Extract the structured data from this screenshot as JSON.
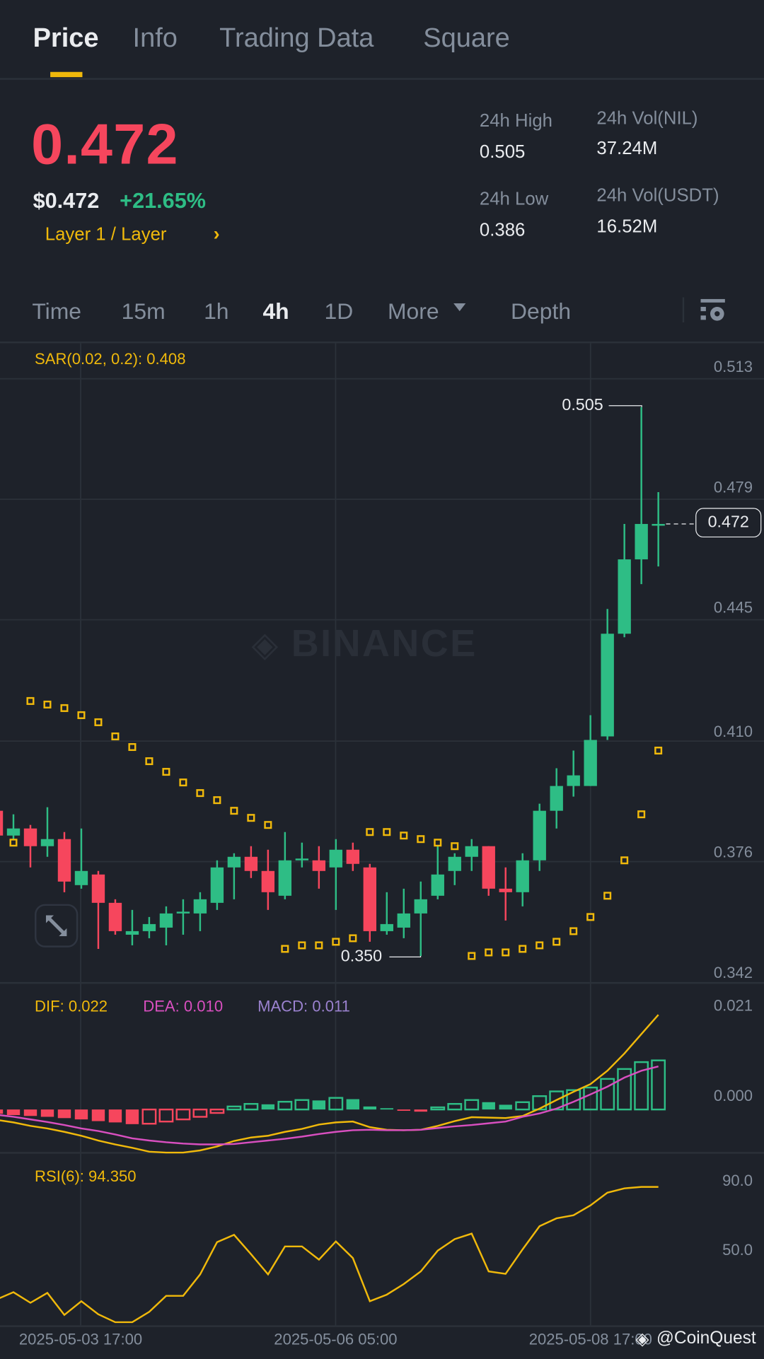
{
  "tabs": [
    {
      "label": "Price",
      "active": true
    },
    {
      "label": "Info"
    },
    {
      "label": "Trading Data"
    },
    {
      "label": "Square"
    }
  ],
  "ticker": {
    "last_price": "0.472",
    "usd_price": "$0.472",
    "change": "+21.65%",
    "category": "Layer 1 / Layer",
    "category_chevron": "›",
    "stats": [
      {
        "label": "24h High",
        "value": "0.505"
      },
      {
        "label": "24h Vol(NIL)",
        "value": "37.24M"
      },
      {
        "label": "24h Low",
        "value": "0.386"
      },
      {
        "label": "24h Vol(USDT)",
        "value": "16.52M"
      }
    ]
  },
  "intervals": {
    "items": [
      "Time",
      "15m",
      "1h",
      "4h",
      "1D"
    ],
    "active": "4h",
    "more": "More",
    "depth": "Depth",
    "settings_icon": "chart-settings-icon"
  },
  "chart": {
    "sar_label": "SAR(0.02, 0.2): 0.408",
    "watermark": "BINANCE",
    "high_marker": "0.505",
    "low_marker": "0.350",
    "current_price": "0.472",
    "macd": {
      "dif": "DIF: 0.022",
      "dea": "DEA: 0.010",
      "macd": "MACD: 0.011"
    },
    "rsi_label": "RSI(6): 94.350",
    "credit": "@CoinQuest",
    "expand_icon": "expand-icon"
  },
  "colors": {
    "up": "#2ebd85",
    "down": "#f6465d",
    "accent": "#f0b90b",
    "dea": "#d94fc0",
    "macd_label": "#9b82cf"
  },
  "chart_data": {
    "type": "candlestick",
    "interval": "4h",
    "price_ticks": [
      "0.513",
      "0.479",
      "0.445",
      "0.410",
      "0.376",
      "0.342"
    ],
    "macd_ticks": [
      "0.021",
      "0.000"
    ],
    "rsi_ticks": [
      "90.0",
      "50.0"
    ],
    "x_labels": [
      "2025-05-03 17:00",
      "2025-05-06 05:00",
      "2025-05-08 17:00"
    ],
    "ohlc": [
      [
        0.391,
        0.392,
        0.383,
        0.384
      ],
      [
        0.384,
        0.39,
        0.383,
        0.386
      ],
      [
        0.386,
        0.387,
        0.375,
        0.381
      ],
      [
        0.381,
        0.392,
        0.378,
        0.383
      ],
      [
        0.383,
        0.385,
        0.368,
        0.371
      ],
      [
        0.37,
        0.386,
        0.369,
        0.374
      ],
      [
        0.373,
        0.374,
        0.352,
        0.365
      ],
      [
        0.365,
        0.366,
        0.356,
        0.357
      ],
      [
        0.356,
        0.363,
        0.353,
        0.357
      ],
      [
        0.357,
        0.361,
        0.355,
        0.359
      ],
      [
        0.358,
        0.364,
        0.353,
        0.362
      ],
      [
        0.362,
        0.366,
        0.356,
        0.3625
      ],
      [
        0.362,
        0.368,
        0.357,
        0.366
      ],
      [
        0.365,
        0.377,
        0.363,
        0.375
      ],
      [
        0.375,
        0.379,
        0.366,
        0.378
      ],
      [
        0.378,
        0.381,
        0.372,
        0.374
      ],
      [
        0.374,
        0.38,
        0.363,
        0.368
      ],
      [
        0.367,
        0.385,
        0.366,
        0.377
      ],
      [
        0.377,
        0.382,
        0.375,
        0.3775
      ],
      [
        0.377,
        0.381,
        0.369,
        0.374
      ],
      [
        0.375,
        0.383,
        0.363,
        0.38
      ],
      [
        0.38,
        0.382,
        0.374,
        0.376
      ],
      [
        0.375,
        0.376,
        0.354,
        0.357
      ],
      [
        0.357,
        0.368,
        0.356,
        0.359
      ],
      [
        0.358,
        0.369,
        0.355,
        0.362
      ],
      [
        0.362,
        0.371,
        0.35,
        0.366
      ],
      [
        0.367,
        0.381,
        0.366,
        0.373
      ],
      [
        0.374,
        0.379,
        0.37,
        0.378
      ],
      [
        0.378,
        0.383,
        0.374,
        0.381
      ],
      [
        0.381,
        0.381,
        0.367,
        0.369
      ],
      [
        0.369,
        0.375,
        0.36,
        0.368
      ],
      [
        0.368,
        0.379,
        0.364,
        0.377
      ],
      [
        0.377,
        0.393,
        0.374,
        0.391
      ],
      [
        0.391,
        0.403,
        0.386,
        0.398
      ],
      [
        0.398,
        0.408,
        0.395,
        0.401
      ],
      [
        0.398,
        0.418,
        0.398,
        0.411
      ],
      [
        0.412,
        0.448,
        0.411,
        0.441
      ],
      [
        0.441,
        0.472,
        0.44,
        0.462
      ],
      [
        0.462,
        0.505,
        0.455,
        0.472
      ],
      [
        0.472,
        0.481,
        0.46,
        0.472
      ]
    ],
    "sar": [
      null,
      0.382,
      0.422,
      0.421,
      0.42,
      0.418,
      0.416,
      0.412,
      0.409,
      0.405,
      0.402,
      0.399,
      0.396,
      0.394,
      0.391,
      0.389,
      0.387,
      0.352,
      0.353,
      0.353,
      0.354,
      0.355,
      0.385,
      0.385,
      0.384,
      0.383,
      0.382,
      0.381,
      0.35,
      0.351,
      0.351,
      0.352,
      0.353,
      0.354,
      0.357,
      0.361,
      0.367,
      0.377,
      0.39,
      0.408
    ],
    "macd_hist": [
      -0.001,
      -0.0013,
      -0.0015,
      -0.0017,
      -0.002,
      -0.0023,
      -0.0027,
      -0.003,
      -0.0034,
      -0.0033,
      -0.0028,
      -0.0023,
      -0.0017,
      -0.0008,
      0.0007,
      0.0013,
      0.0012,
      0.0018,
      0.0022,
      0.0021,
      0.0027,
      0.0024,
      0.0007,
      0.0003,
      -0.0002,
      -0.0005,
      0.0005,
      0.0013,
      0.0022,
      0.0017,
      0.0011,
      0.0017,
      0.0031,
      0.0042,
      0.0045,
      0.0051,
      0.0071,
      0.0094,
      0.011,
      0.0114
    ],
    "dif": [
      -0.0024,
      -0.003,
      -0.0038,
      -0.0044,
      -0.0052,
      -0.0061,
      -0.0072,
      -0.0081,
      -0.0089,
      -0.0098,
      -0.01,
      -0.01,
      -0.0095,
      -0.0086,
      -0.0073,
      -0.0065,
      -0.0061,
      -0.0052,
      -0.0045,
      -0.0035,
      -0.003,
      -0.0028,
      -0.0041,
      -0.0047,
      -0.0048,
      -0.0047,
      -0.0038,
      -0.0027,
      -0.0018,
      -0.0019,
      -0.002,
      -0.0015,
      0.0002,
      0.0022,
      0.0041,
      0.0059,
      0.009,
      0.013,
      0.0175,
      0.022
    ],
    "dea": [
      -0.0012,
      -0.0017,
      -0.0023,
      -0.0029,
      -0.0036,
      -0.0044,
      -0.005,
      -0.0058,
      -0.0067,
      -0.0072,
      -0.0076,
      -0.0079,
      -0.0081,
      -0.0081,
      -0.008,
      -0.0076,
      -0.0072,
      -0.0068,
      -0.0063,
      -0.0057,
      -0.0052,
      -0.0048,
      -0.0047,
      -0.0048,
      -0.0048,
      -0.0047,
      -0.0043,
      -0.0039,
      -0.0036,
      -0.0032,
      -0.0028,
      -0.0017,
      -0.0009,
      0.0002,
      0.0018,
      0.0035,
      0.0053,
      0.0074,
      0.009,
      0.01
    ],
    "rsi": [
      29.4,
      33.6,
      27.5,
      33.2,
      20.5,
      28.4,
      20.9,
      16.3,
      16.3,
      22.3,
      31.5,
      31.5,
      43.9,
      62.5,
      66.7,
      55.5,
      43.9,
      60.0,
      60.0,
      52.4,
      62.9,
      53.3,
      28.4,
      32.2,
      38.3,
      45.6,
      57.6,
      64.2,
      67.4,
      45.6,
      44.2,
      58.3,
      71.7,
      76.2,
      78.0,
      83.7,
      91.0,
      93.5,
      94.35,
      94.35
    ],
    "grid": true
  }
}
